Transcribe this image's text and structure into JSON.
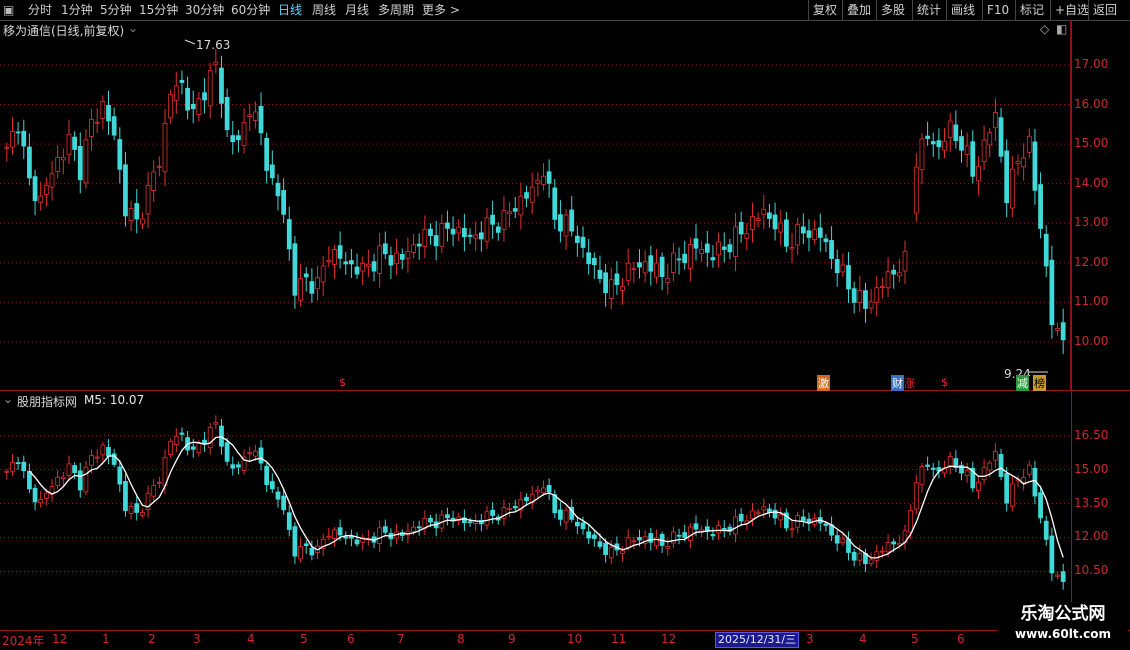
{
  "toolbar": {
    "periods": [
      "分时",
      "1分钟",
      "5分钟",
      "15分钟",
      "30分钟",
      "60分钟",
      "日线",
      "周线",
      "月线",
      "多周期",
      "更多 >"
    ],
    "active_period": "日线",
    "tools": [
      "复权",
      "叠加",
      "多股",
      "统计",
      "画线",
      "F10",
      "标记",
      "+自选",
      "返回"
    ]
  },
  "main_panel": {
    "title": "移为通信(日线,前复权)",
    "high_label": "17.63",
    "low_label": "9.24",
    "y_ticks": [
      "17.00",
      "16.00",
      "15.00",
      "14.00",
      "13.00",
      "12.00",
      "11.00",
      "10.00"
    ],
    "markers": [
      "$",
      "激",
      "财",
      "涨",
      "$",
      "减",
      "榜"
    ]
  },
  "indicator_panel": {
    "title": "股朋指标网",
    "ma_label": "M5: 10.07",
    "y_ticks": [
      "16.50",
      "15.00",
      "13.50",
      "12.00",
      "10.50"
    ]
  },
  "x_axis": {
    "labels": [
      "2024年",
      "12",
      "1",
      "2",
      "3",
      "4",
      "5",
      "6",
      "7",
      "8",
      "9",
      "10",
      "11",
      "12",
      "3",
      "4",
      "5",
      "6"
    ],
    "cursor_date": "2025/12/31/三"
  },
  "watermark": {
    "line1": "乐淘公式网",
    "line2": "www.60lt.com"
  },
  "colors": {
    "up": "#e03030",
    "down": "#40d8d8",
    "ma": "#ffffff",
    "grid": "#9a1212",
    "cursor_bg": "#1a1a8c"
  },
  "chart_data": {
    "type": "candlestick",
    "price_ylim": [
      9.24,
      17.63
    ],
    "path_anchors": [
      [
        0,
        14.8
      ],
      [
        2,
        15.6
      ],
      [
        4,
        14.0
      ],
      [
        6,
        13.6
      ],
      [
        9,
        14.6
      ],
      [
        11,
        15.1
      ],
      [
        13,
        14.4
      ],
      [
        15,
        15.5
      ],
      [
        17,
        16.0
      ],
      [
        19,
        15.2
      ],
      [
        21,
        13.4
      ],
      [
        23,
        13.0
      ],
      [
        25,
        13.8
      ],
      [
        27,
        14.6
      ],
      [
        29,
        16.3
      ],
      [
        31,
        16.5
      ],
      [
        33,
        15.7
      ],
      [
        35,
        16.4
      ],
      [
        37,
        17.0
      ],
      [
        39,
        15.3
      ],
      [
        41,
        15.0
      ],
      [
        43,
        16.0
      ],
      [
        45,
        15.2
      ],
      [
        47,
        14.0
      ],
      [
        49,
        13.3
      ],
      [
        51,
        11.3
      ],
      [
        53,
        11.6
      ],
      [
        55,
        11.4
      ],
      [
        57,
        12.3
      ],
      [
        60,
        12.0
      ],
      [
        63,
        11.8
      ],
      [
        66,
        12.2
      ],
      [
        70,
        12.1
      ],
      [
        73,
        12.6
      ],
      [
        76,
        12.7
      ],
      [
        79,
        12.9
      ],
      [
        82,
        12.6
      ],
      [
        85,
        12.9
      ],
      [
        88,
        13.1
      ],
      [
        91,
        13.6
      ],
      [
        93,
        13.8
      ],
      [
        95,
        14.4
      ],
      [
        97,
        13.1
      ],
      [
        99,
        13.0
      ],
      [
        101,
        12.6
      ],
      [
        104,
        11.8
      ],
      [
        107,
        11.3
      ],
      [
        110,
        11.8
      ],
      [
        113,
        12.0
      ],
      [
        116,
        11.7
      ],
      [
        119,
        12.1
      ],
      [
        122,
        12.4
      ],
      [
        125,
        12.2
      ],
      [
        128,
        12.5
      ],
      [
        131,
        12.9
      ],
      [
        134,
        13.3
      ],
      [
        136,
        13.0
      ],
      [
        138,
        12.5
      ],
      [
        141,
        12.8
      ],
      [
        144,
        12.7
      ],
      [
        147,
        11.9
      ],
      [
        150,
        11.2
      ],
      [
        152,
        10.9
      ],
      [
        154,
        11.3
      ],
      [
        157,
        11.8
      ],
      [
        159,
        12.0
      ],
      [
        161,
        14.6
      ],
      [
        163,
        15.2
      ],
      [
        165,
        14.9
      ],
      [
        167,
        15.4
      ],
      [
        169,
        15.0
      ],
      [
        171,
        14.3
      ],
      [
        173,
        14.9
      ],
      [
        175,
        15.8
      ],
      [
        177,
        13.6
      ],
      [
        179,
        14.7
      ],
      [
        181,
        14.9
      ],
      [
        183,
        13.0
      ],
      [
        185,
        10.5
      ],
      [
        187,
        10.1
      ]
    ],
    "trading_days": 188,
    "ma_period": 5
  }
}
